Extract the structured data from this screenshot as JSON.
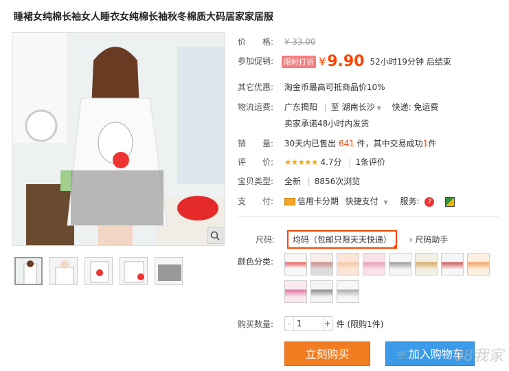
{
  "title": "睡裙女纯棉长袖女人睡衣女纯棉长袖秋冬棉质大码居家家居服",
  "price": {
    "label": "价　　格:",
    "original": "¥ 33.00"
  },
  "promo": {
    "label": "参加促销:",
    "badge": "限时打折",
    "yen": "¥",
    "price": "9.90",
    "countdown": "52小时19分钟 后结束"
  },
  "other": {
    "label": "其它优惠:",
    "text": "淘金币最高可抵商品价10%"
  },
  "shipping": {
    "label": "物流运费:",
    "from": "广东揭阳",
    "to_prefix": "至",
    "to": "湖南长沙",
    "fee": "快递: 免运费",
    "promise": "卖家承诺48小时内发货"
  },
  "sales": {
    "label": "销　　量:",
    "pre": "30天内已售出",
    "count": "641",
    "mid": "件，其中交易成功",
    "success": "1",
    "post": "件"
  },
  "review": {
    "label": "评　　价:",
    "stars": "★★★★★",
    "score": "4.7分",
    "count": "1条评价"
  },
  "type": {
    "label": "宝贝类型:",
    "cond": "全新",
    "views": "8856次浏览"
  },
  "payment": {
    "label": "支　　付:",
    "credit": "信用卡分期",
    "quick": "快捷支付",
    "service_label": "服务:"
  },
  "size": {
    "label": "尺码:",
    "value": "均码（包邮只限天天快递）",
    "helper": "尺码助手"
  },
  "color": {
    "label": "颜色分类:"
  },
  "qty": {
    "label": "购买数量:",
    "minus": "-",
    "value": "1",
    "plus": "+",
    "limit": "件 (限购1件)"
  },
  "buttons": {
    "buy": "立刻购买",
    "cart": "加入购物车"
  },
  "watermark": "08我家",
  "colors": {
    "accent": "#ff4400",
    "buy": "#f27c21",
    "cart": "#3c9be8"
  }
}
